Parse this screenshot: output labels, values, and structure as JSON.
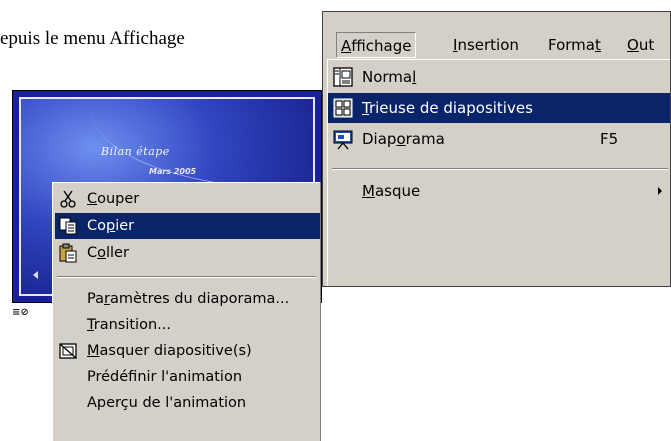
{
  "caption": "epuis le menu Affichage",
  "slide": {
    "title": "Bilan étape",
    "subtitle": "Mars 2005"
  },
  "context_menu": {
    "items": [
      {
        "pre": "",
        "u": "C",
        "post": "ouper",
        "icon": "scissors-icon"
      },
      {
        "pre": "Co",
        "u": "p",
        "post": "ier",
        "icon": "copy-icon"
      },
      {
        "pre": "C",
        "u": "o",
        "post": "ller",
        "icon": "paste-icon"
      },
      {
        "pre": "Pa",
        "u": "r",
        "post": "amètres du diaporama...",
        "icon": ""
      },
      {
        "pre": "",
        "u": "T",
        "post": "ransition...",
        "icon": ""
      },
      {
        "pre": "",
        "u": "M",
        "post": "asquer diapositive(s)",
        "icon": "hide-slide-icon"
      },
      {
        "pre": "Prédéf",
        "u": "i",
        "post": "nir l'animation",
        "icon": ""
      },
      {
        "pre": "Aperçu de l'animation",
        "u": "",
        "post": "",
        "icon": ""
      }
    ]
  },
  "menubar": {
    "items": [
      {
        "pre": "",
        "u": "A",
        "post": "ffichage"
      },
      {
        "pre": "",
        "u": "I",
        "post": "nsertion"
      },
      {
        "pre": "Forma",
        "u": "t",
        "post": ""
      },
      {
        "pre": "",
        "u": "O",
        "post": "ut"
      }
    ]
  },
  "view_menu": {
    "items": [
      {
        "pre": "Norma",
        "u": "l",
        "post": "",
        "shortcut": "",
        "icon": "normal-view-icon"
      },
      {
        "pre": "",
        "u": "T",
        "post": "rieuse de diapositives",
        "shortcut": "",
        "icon": "slide-sorter-icon"
      },
      {
        "pre": "Diap",
        "u": "o",
        "post": "rama",
        "shortcut": "F5",
        "icon": "slideshow-icon"
      },
      {
        "pre": "",
        "u": "M",
        "post": "asque",
        "shortcut": "",
        "icon": ""
      }
    ]
  },
  "colors": {
    "menu_bg": "#d4d0c8",
    "highlight": "#0a246a",
    "slide_bg": "#1a1f9a"
  }
}
